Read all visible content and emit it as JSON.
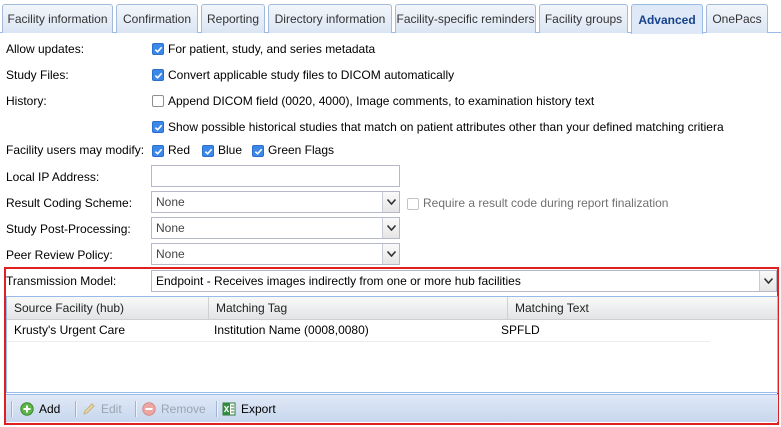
{
  "tabs": [
    {
      "label": "Facility information",
      "active": false
    },
    {
      "label": "Confirmation",
      "active": false
    },
    {
      "label": "Reporting",
      "active": false
    },
    {
      "label": "Directory information",
      "active": false
    },
    {
      "label": "Facility-specific reminders",
      "active": false
    },
    {
      "label": "Facility groups",
      "active": false
    },
    {
      "label": "Advanced",
      "active": true
    },
    {
      "label": "OnePacs",
      "active": false
    }
  ],
  "form": {
    "allow_updates": {
      "label": "Allow updates:",
      "option": "For patient, study, and series metadata",
      "checked": true
    },
    "study_files": {
      "label": "Study Files:",
      "option": "Convert applicable study files to DICOM automatically",
      "checked": true
    },
    "history": {
      "label": "History:",
      "option1": "Append DICOM field (0020, 4000), Image comments, to examination history text",
      "option1_checked": false,
      "option2": "Show possible historical studies that match on patient attributes other than your defined matching critiera",
      "option2_checked": true
    },
    "facility_users": {
      "label": "Facility users may modify:",
      "red": "Red",
      "blue": "Blue",
      "green": "Green Flags"
    },
    "local_ip": {
      "label": "Local IP Address:",
      "value": ""
    },
    "result_coding": {
      "label": "Result Coding Scheme:",
      "value": "None",
      "require_label": "Require a result code during report finalization"
    },
    "post_processing": {
      "label": "Study Post-Processing:",
      "value": "None"
    },
    "peer_review": {
      "label": "Peer Review Policy:",
      "value": "None"
    }
  },
  "transmission": {
    "label": "Transmission Model:",
    "value": "Endpoint - Receives images indirectly from one or more hub facilities",
    "columns": [
      "Source Facility (hub)",
      "Matching Tag",
      "Matching Text"
    ],
    "rows": [
      [
        "Krusty's Urgent Care",
        "Institution Name (0008,0080)",
        "SPFLD"
      ]
    ],
    "toolbar": {
      "add": "Add",
      "edit": "Edit",
      "remove": "Remove",
      "export": "Export"
    }
  },
  "colors": {
    "checkbox_checked": "#3b88e8",
    "highlight_border": "#e02020",
    "tab_active_text": "#15428b"
  }
}
